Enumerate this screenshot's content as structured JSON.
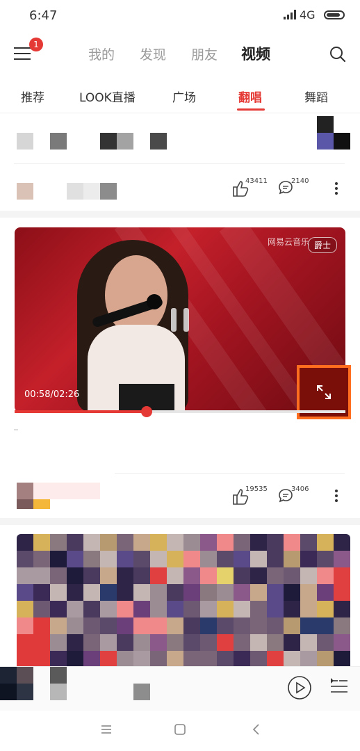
{
  "status_bar": {
    "time": "6:47",
    "network": "4G"
  },
  "header": {
    "badge_count": "1",
    "tabs": [
      {
        "label": "我的",
        "active": false
      },
      {
        "label": "发现",
        "active": false
      },
      {
        "label": "朋友",
        "active": false
      },
      {
        "label": "视频",
        "active": true
      }
    ]
  },
  "channels": [
    {
      "label": "推荐",
      "active": false
    },
    {
      "label": "LOOK直播",
      "active": false
    },
    {
      "label": "广场",
      "active": false
    },
    {
      "label": "翻唱",
      "active": true
    },
    {
      "label": "舞蹈",
      "active": false
    }
  ],
  "feed": {
    "item1": {
      "likes": "43411",
      "comments": "2140"
    },
    "video": {
      "watermark": "网易云音乐",
      "tag": "爵士",
      "current_time": "00:58",
      "duration": "/02:26",
      "progress": 0.4
    },
    "item2": {
      "likes": "19535",
      "comments": "3406"
    }
  },
  "colors": {
    "accent": "#e53935",
    "highlight_box": "#ff6d1f"
  },
  "icons": [
    "menu-icon",
    "search-icon",
    "like-icon",
    "comment-icon",
    "more-icon",
    "pause-icon",
    "fullscreen-icon",
    "play-icon",
    "playlist-icon"
  ]
}
